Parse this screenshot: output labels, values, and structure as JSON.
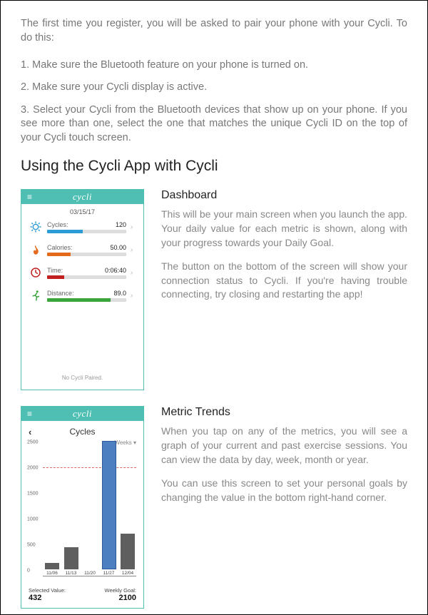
{
  "intro": "The first time you register, you will be asked to pair your phone with your Cycli. To do this:",
  "steps": [
    "1. Make sure the Bluetooth feature on your phone is turned on.",
    "2. Make sure your Cycli display is active.",
    "3. Select your Cycli from the Bluetooth devices that show up on your phone.  If you see more than one, select the one that matches the unique Cycli ID on the top of your Cycli touch screen."
  ],
  "section_title": "Using the Cycli App with Cycli",
  "dashboard": {
    "heading": "Dashboard",
    "p1": "This will be your main screen when you launch the app. Your daily value for each metric is shown, along with your progress towards your Daily Goal.",
    "p2": "The button on the bottom of the screen will show your connection status to Cycli. If you're having trouble connecting, try closing and restarting the app!"
  },
  "trends": {
    "heading": "Metric Trends",
    "p1": "When you tap on any of the metrics, you will see a graph of your current and past exercise sessions. You can view the data by day, week, month or year.",
    "p2": "You can use this screen to set your personal goals by changing the value in the bottom right-hand corner."
  },
  "phone": {
    "brand": "cycli",
    "date": "03/15/17",
    "metrics": [
      {
        "label": "Cycles:",
        "value": "120",
        "color": "#2d9bd6",
        "pct": 45
      },
      {
        "label": "Calories:",
        "value": "50.00",
        "color": "#e46a1e",
        "pct": 30
      },
      {
        "label": "Time:",
        "value": "0:06:40",
        "color": "#c22020",
        "pct": 22
      },
      {
        "label": "Distance:",
        "value": "89.0",
        "color": "#3aa53a",
        "pct": 80
      }
    ],
    "footer": "No Cycli Paired."
  },
  "trends_phone": {
    "title": "Cycles",
    "range_label": "Weeks ▾",
    "selected_label": "Selected Value:",
    "selected_value": "432",
    "goal_label": "Weekly Goal:",
    "goal_value": "2100"
  },
  "chart_data": {
    "type": "bar",
    "title": "Cycles",
    "xlabel": "",
    "ylabel": "",
    "ylim": [
      0,
      2500
    ],
    "yticks": [
      0,
      500,
      1000,
      1500,
      2000,
      2500
    ],
    "goal_line": 2100,
    "categories": [
      "11/06",
      "11/13",
      "11/20",
      "11/27",
      "12/04"
    ],
    "values": [
      130,
      432,
      0,
      2500,
      700
    ],
    "highlight_index": 3
  }
}
